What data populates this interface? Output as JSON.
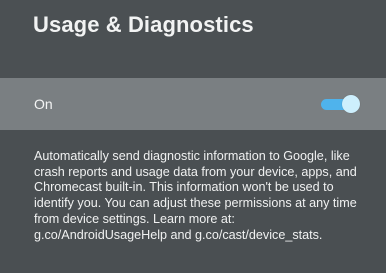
{
  "header": {
    "title": "Usage & Diagnostics"
  },
  "setting": {
    "label": "On",
    "toggle_state": "on",
    "accent_color": "#4fb3ec"
  },
  "description": {
    "text": "Automatically send diagnostic information to Google, like crash reports and usage data from your device, apps, and Chromecast built-in. This information won't be used to identify you. You can adjust these permissions at any time from device settings. Learn more at: g.co/AndroidUsageHelp and g.co/cast/device_stats."
  },
  "colors": {
    "background": "#4a4f52",
    "selected_row": "#7a7f82",
    "text": "#f2f3f3"
  }
}
